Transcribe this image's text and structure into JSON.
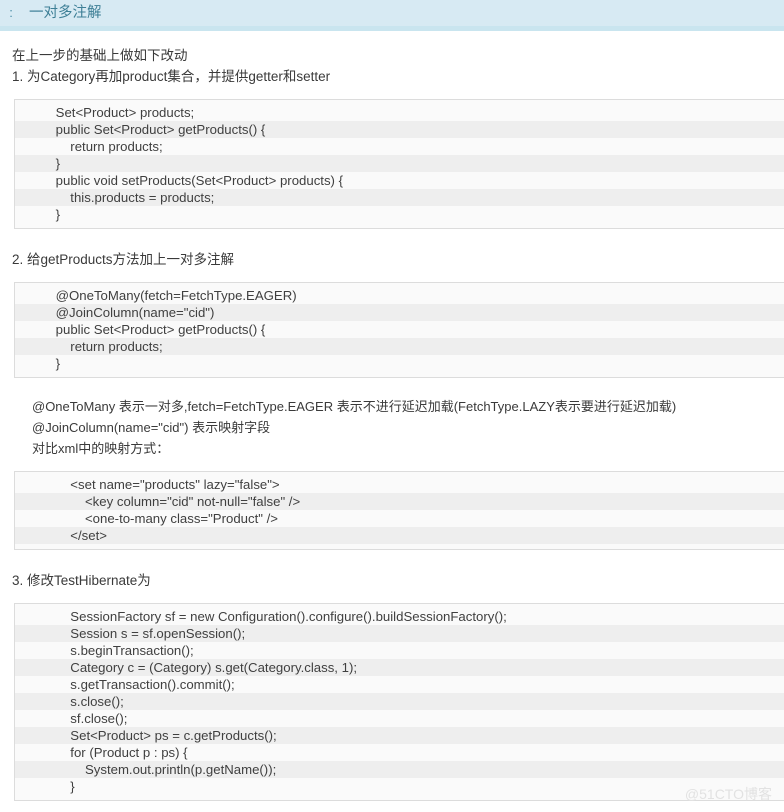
{
  "header": {
    "prefix": ":",
    "title": "一对多注解",
    "bg_color": "#d7eaf3",
    "text_color": "#3d7f96"
  },
  "intro": {
    "line": "在上一步的基础上做如下改动"
  },
  "steps": [
    {
      "heading": "1. 为Category再加product集合，并提供getter和setter",
      "code": [
        "    Set<Product> products;",
        "    public Set<Product> getProducts() {",
        "        return products;",
        "    }",
        "    public void setProducts(Set<Product> products) {",
        "        this.products = products;",
        "    }"
      ]
    },
    {
      "heading": "2. 给getProducts方法加上一对多注解",
      "code": [
        "    @OneToMany(fetch=FetchType.EAGER)",
        "    @JoinColumn(name=\"cid\")",
        "    public Set<Product> getProducts() {",
        "        return products;",
        "    }"
      ],
      "notes": [
        "@OneToMany 表示一对多,fetch=FetchType.EAGER 表示不进行延迟加载(FetchType.LAZY表示要进行延迟加载)",
        "@JoinColumn(name=\"cid\") 表示映射字段",
        "对比xml中的映射方式："
      ],
      "xml_code": [
        "        <set name=\"products\" lazy=\"false\">",
        "            <key column=\"cid\" not-null=\"false\" />",
        "            <one-to-many class=\"Product\" />",
        "        </set>"
      ]
    },
    {
      "heading": "3. 修改TestHibernate为",
      "code": [
        "        SessionFactory sf = new Configuration().configure().buildSessionFactory();",
        "        Session s = sf.openSession();",
        "        s.beginTransaction();",
        "        Category c = (Category) s.get(Category.class, 1);",
        "        s.getTransaction().commit();",
        "        s.close();",
        "        sf.close();",
        "        Set<Product> ps = c.getProducts();",
        "        for (Product p : ps) {",
        "            System.out.println(p.getName());",
        "        }"
      ]
    }
  ],
  "watermark": "@51CTO博客",
  "colors": {
    "code_stripe_dark": "#eeeeee",
    "code_stripe_light": "#fafafa",
    "code_border": "#dcdcdc",
    "watermark": "#e2e2e2"
  }
}
